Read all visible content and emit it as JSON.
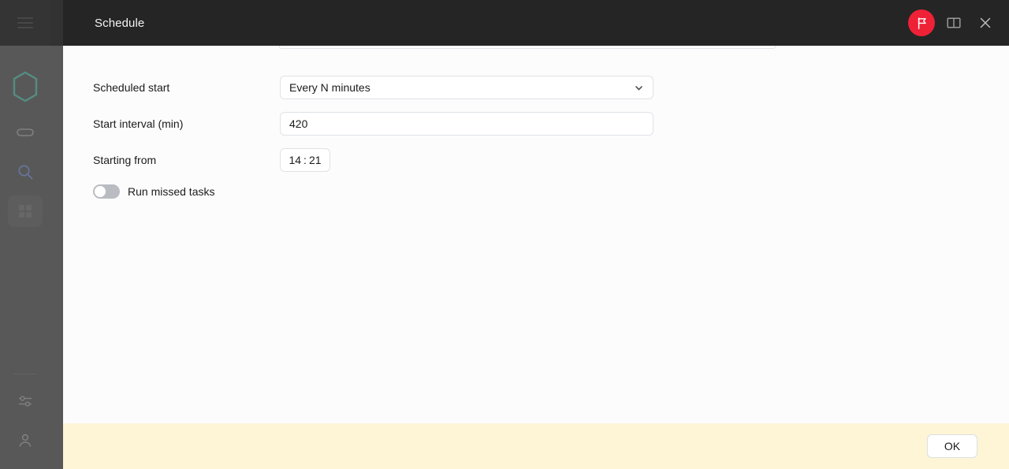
{
  "app": {
    "rail": {
      "menu_icon": "hamburger-icon",
      "logo_icon": "brand-hexagon-logo",
      "items": [
        {
          "icon": "pill-icon",
          "active": false
        },
        {
          "icon": "search-icon",
          "active": false
        },
        {
          "icon": "grid-icon",
          "active": true
        }
      ],
      "bottom_items": [
        {
          "icon": "sliders-settings-icon"
        },
        {
          "icon": "user-account-icon"
        }
      ]
    }
  },
  "modal": {
    "title": "Schedule",
    "header_actions": [
      {
        "name": "flag-button",
        "icon": "flag-icon",
        "color": "#ef2137"
      },
      {
        "name": "manual-button",
        "icon": "book-icon"
      },
      {
        "name": "close-button",
        "icon": "close-icon"
      }
    ],
    "form": {
      "scheduled_start": {
        "label": "Scheduled start",
        "value": "Every N minutes",
        "chevron": "chevron-down-icon"
      },
      "start_interval": {
        "label": "Start interval (min)",
        "value": "420",
        "placeholder": ""
      },
      "starting_from": {
        "label": "Starting from",
        "hours": "14",
        "separator": ":",
        "minutes": "21"
      },
      "run_missed_tasks": {
        "label": "Run missed tasks",
        "checked": false
      }
    },
    "footer": {
      "ok_label": "OK"
    }
  },
  "colors": {
    "accent_red": "#ef2137",
    "brand_teal": "#0f9b7e",
    "footer_bg": "#fdf5d5",
    "header_bg": "#252525",
    "rail_bg": "#141414",
    "search_blue": "#3b5fc0"
  }
}
